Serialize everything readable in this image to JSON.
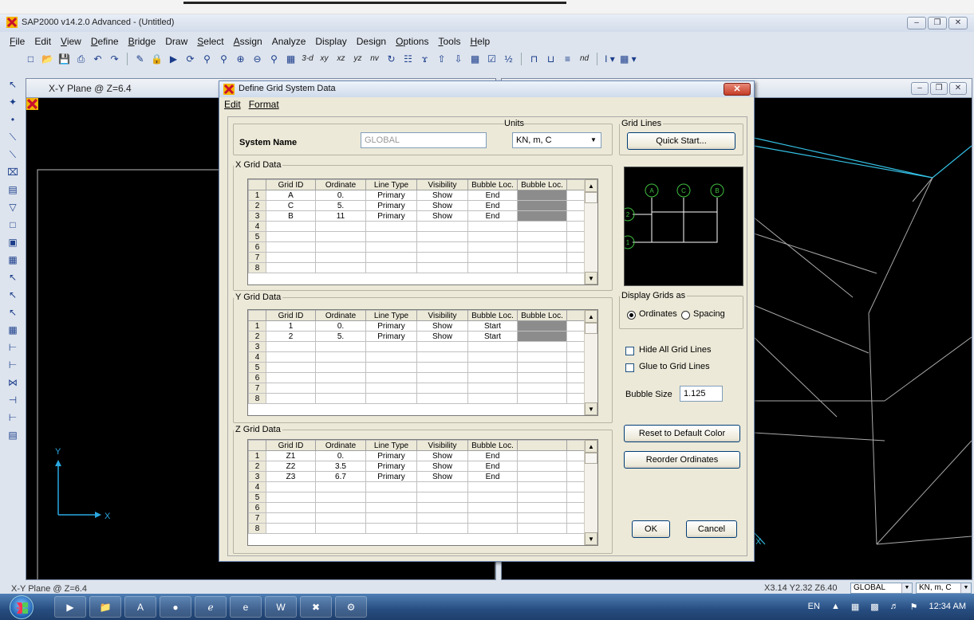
{
  "app": {
    "title": "SAP2000 v14.2.0 Advanced  - (Untitled)",
    "menu": [
      {
        "u": "F",
        "rest": "ile"
      },
      {
        "u": "",
        "rest": "Edit"
      },
      {
        "u": "V",
        "rest": "iew"
      },
      {
        "u": "D",
        "rest": "efine"
      },
      {
        "u": "B",
        "rest": "ridge"
      },
      {
        "u": "",
        "rest": "Draw"
      },
      {
        "u": "S",
        "rest": "elect"
      },
      {
        "u": "A",
        "rest": "ssign"
      },
      {
        "u": "",
        "rest": "Analyze"
      },
      {
        "u": "",
        "rest": "Display"
      },
      {
        "u": "",
        "rest": "Design"
      },
      {
        "u": "O",
        "rest": "ptions"
      },
      {
        "u": "T",
        "rest": "ools"
      },
      {
        "u": "H",
        "rest": "elp"
      }
    ],
    "toolbar_text": {
      "three_d": "3-d",
      "xy": "xy",
      "xz": "xz",
      "yz": "yz",
      "nv": "nv",
      "nd": "nd"
    }
  },
  "view1": {
    "title": "X-Y Plane @ Z=6.4"
  },
  "status": {
    "left": "X-Y Plane @ Z=6.4",
    "coords": "X3.14  Y2.32  Z6.40",
    "coord_system": "GLOBAL",
    "units": "KN, m, C"
  },
  "taskbar": {
    "lang": "EN",
    "time": "12:34 AM"
  },
  "dialog": {
    "title": "Define Grid System Data",
    "menu": {
      "edit": "Edit",
      "format": "Format"
    },
    "system_name_label": "System Name",
    "system_name_value": "GLOBAL",
    "units_label": "Units",
    "units_value": "KN, m, C",
    "grid_lines_label": "Grid Lines",
    "quick_start": "Quick Start...",
    "x_grid": {
      "label": "X Grid Data",
      "headers": [
        "Grid ID",
        "Ordinate",
        "Line Type",
        "Visibility",
        "Bubble Loc.",
        "Bubble Loc."
      ],
      "rows": [
        [
          "A",
          "0.",
          "Primary",
          "Show",
          "End"
        ],
        [
          "C",
          "5.",
          "Primary",
          "Show",
          "End"
        ],
        [
          "B",
          "11",
          "Primary",
          "Show",
          "End"
        ]
      ],
      "row_numbers": [
        "1",
        "2",
        "3",
        "4",
        "5",
        "6",
        "7",
        "8"
      ]
    },
    "y_grid": {
      "label": "Y Grid Data",
      "headers": [
        "Grid ID",
        "Ordinate",
        "Line Type",
        "Visibility",
        "Bubble Loc.",
        "Bubble Loc."
      ],
      "rows": [
        [
          "1",
          "0.",
          "Primary",
          "Show",
          "Start"
        ],
        [
          "2",
          "5.",
          "Primary",
          "Show",
          "Start"
        ]
      ],
      "row_numbers": [
        "1",
        "2",
        "3",
        "4",
        "5",
        "6",
        "7",
        "8"
      ]
    },
    "z_grid": {
      "label": "Z Grid Data",
      "headers": [
        "Grid ID",
        "Ordinate",
        "Line Type",
        "Visibility",
        "Bubble Loc."
      ],
      "rows": [
        [
          "Z1",
          "0.",
          "Primary",
          "Show",
          "End"
        ],
        [
          "Z2",
          "3.5",
          "Primary",
          "Show",
          "End"
        ],
        [
          "Z3",
          "6.7",
          "Primary",
          "Show",
          "End"
        ]
      ],
      "row_numbers": [
        "1",
        "2",
        "3",
        "4",
        "5",
        "6",
        "7",
        "8"
      ]
    },
    "preview_bubbles": {
      "x": [
        "A",
        "C",
        "B"
      ],
      "y": [
        "2",
        "1"
      ]
    },
    "display_grids_label": "Display Grids as",
    "ordinates": "Ordinates",
    "spacing": "Spacing",
    "hide_all": "Hide All Grid Lines",
    "glue": "Glue to Grid Lines",
    "bubble_size_label": "Bubble Size",
    "bubble_size_value": "1.125",
    "reset_color": "Reset to Default Color",
    "reorder": "Reorder Ordinates",
    "ok": "OK",
    "cancel": "Cancel"
  }
}
